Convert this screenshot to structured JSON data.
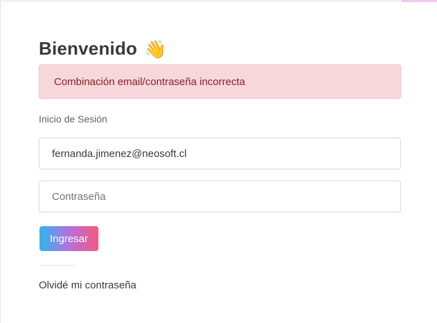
{
  "login": {
    "title": "Bienvenido",
    "title_icon": "waving-hand-icon",
    "alert": "Combinación email/contraseña incorrecta",
    "section_label": "Inicio de Sesión",
    "email_value": "fernanda.jimenez@neosoft.cl",
    "password_placeholder": "Contraseña",
    "submit_label": "Ingresar",
    "forgot_link": "Olvidé mi contraseña"
  },
  "colors": {
    "alert_bg": "#f8d7da",
    "alert_text": "#842029",
    "button_gradient": [
      "#2fb6ec",
      "#b76fe0",
      "#f45a79"
    ]
  }
}
